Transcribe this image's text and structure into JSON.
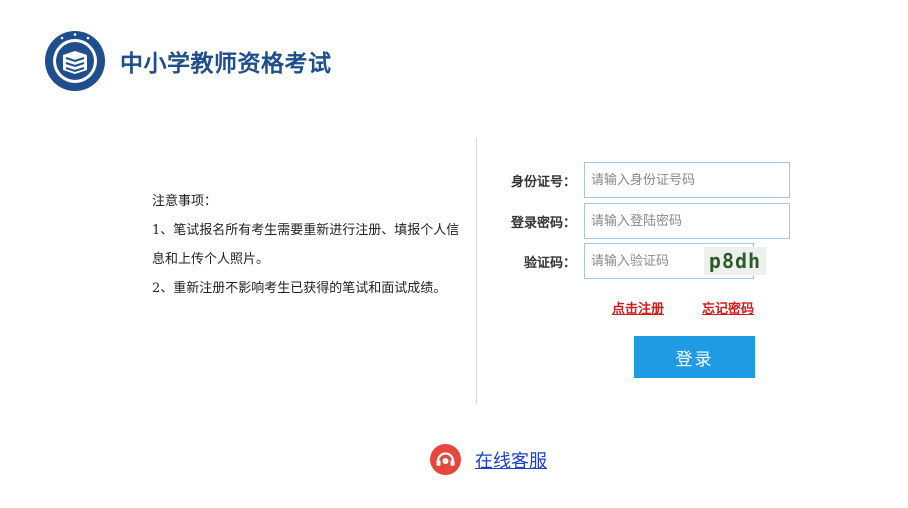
{
  "header": {
    "title": "中小学教师资格考试",
    "logo_icon": "seal-book-icon",
    "brand_color": "#1f4e8c"
  },
  "notice": {
    "title": "注意事项：",
    "items": [
      "1、笔试报名所有考生需要重新进行注册、填报个人信息和上传个人照片。",
      "2、重新注册不影响考生已获得的笔试和面试成绩。"
    ]
  },
  "form": {
    "id_label": "身份证号：",
    "id_placeholder": "请输入身份证号码",
    "password_label": "登录密码：",
    "password_placeholder": "请输入登陆密码",
    "captcha_label": "验证码：",
    "captcha_placeholder": "请输入验证码",
    "captcha_text": "p8dh",
    "register_link": "点击注册",
    "forgot_link": "忘记密码",
    "login_button": "登录",
    "button_color": "#1e9be2",
    "link_color": "#d01c1c"
  },
  "service": {
    "label": "在线客服",
    "icon": "headset-icon",
    "icon_color": "#e8453c"
  }
}
